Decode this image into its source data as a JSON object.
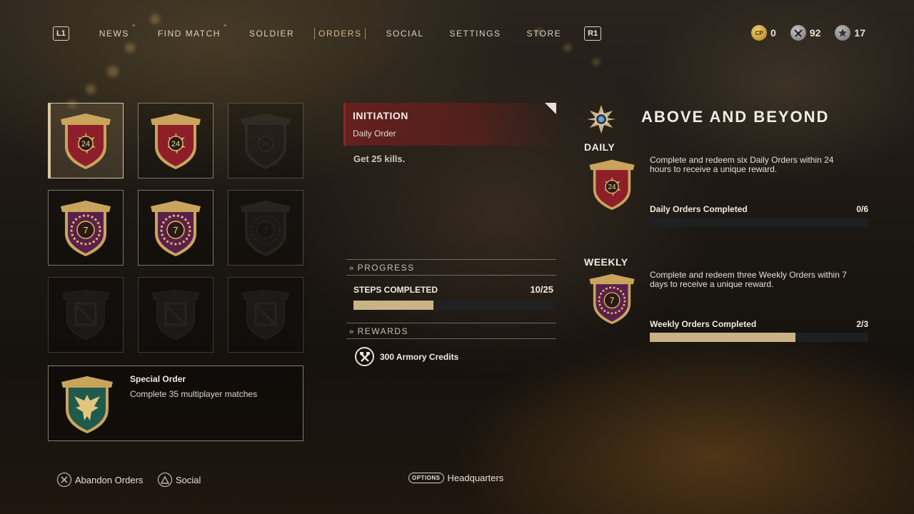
{
  "nav": {
    "left_button": "L1",
    "right_button": "R1",
    "items": [
      {
        "label": "NEWS",
        "badge": "*"
      },
      {
        "label": "FIND MATCH",
        "badge": "*"
      },
      {
        "label": "SOLDIER"
      },
      {
        "label": "ORDERS",
        "active": true
      },
      {
        "label": "SOCIAL"
      },
      {
        "label": "SETTINGS"
      },
      {
        "label": "STORE"
      }
    ]
  },
  "currencies": [
    {
      "icon": "cp-coin-icon",
      "abbr": "CP",
      "value": "0"
    },
    {
      "icon": "armory-credits-icon",
      "value": "92"
    },
    {
      "icon": "supply-drop-icon",
      "value": "17"
    }
  ],
  "orders_grid": [
    {
      "kind": "daily",
      "number": "24",
      "state": "selected"
    },
    {
      "kind": "daily",
      "number": "24",
      "state": "active"
    },
    {
      "kind": "daily",
      "number": "24",
      "state": "dim"
    },
    {
      "kind": "weekly",
      "number": "7",
      "state": "active"
    },
    {
      "kind": "weekly",
      "number": "7",
      "state": "active"
    },
    {
      "kind": "weekly",
      "number": "7",
      "state": "dim"
    },
    {
      "kind": "empty",
      "state": "empty"
    },
    {
      "kind": "empty",
      "state": "empty"
    },
    {
      "kind": "empty",
      "state": "empty"
    }
  ],
  "special_order": {
    "title": "Special Order",
    "description": "Complete 35 multiplayer matches"
  },
  "selected_order": {
    "name": "INITIATION",
    "type": "Daily Order",
    "description": "Get 25 kills.",
    "progress_section": "PROGRESS",
    "steps_label": "STEPS COMPLETED",
    "steps_value": "10/25",
    "steps_fraction": 0.4,
    "rewards_section": "REWARDS",
    "reward": "300 Armory Credits"
  },
  "challenge": {
    "title": "ABOVE AND BEYOND",
    "daily": {
      "label": "DAILY",
      "description": "Complete and redeem six Daily Orders within 24 hours to receive a unique reward.",
      "progress_label": "Daily Orders Completed",
      "progress_value": "0/6",
      "fraction": 0.0
    },
    "weekly": {
      "label": "WEEKLY",
      "description": "Complete and redeem three Weekly Orders within 7 days to receive a unique reward.",
      "progress_label": "Weekly Orders Completed",
      "progress_value": "2/3",
      "fraction": 0.667
    }
  },
  "prompts": {
    "abandon": {
      "button": "cross-button-icon",
      "label": "Abandon Orders"
    },
    "social": {
      "button": "triangle-button-icon",
      "label": "Social"
    },
    "options": {
      "button_text": "OPTIONS",
      "label": "Headquarters"
    }
  },
  "colors": {
    "accent_gold": "#c9b285",
    "order_red": "#8c2626",
    "weekly_purple": "#5a1f4a"
  }
}
